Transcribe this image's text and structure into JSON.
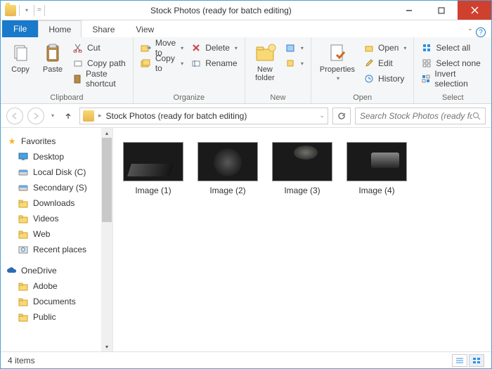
{
  "window": {
    "title": "Stock Photos (ready for batch editing)"
  },
  "tabs": {
    "file": "File",
    "home": "Home",
    "share": "Share",
    "view": "View"
  },
  "ribbon": {
    "clipboard": {
      "label": "Clipboard",
      "copy": "Copy",
      "paste": "Paste",
      "cut": "Cut",
      "copypath": "Copy path",
      "pasteshortcut": "Paste shortcut"
    },
    "organize": {
      "label": "Organize",
      "moveto": "Move to",
      "copyto": "Copy to",
      "delete": "Delete",
      "rename": "Rename"
    },
    "new": {
      "label": "New",
      "newfolder": "New\nfolder"
    },
    "open": {
      "label": "Open",
      "properties": "Properties",
      "open": "Open",
      "edit": "Edit",
      "history": "History"
    },
    "select": {
      "label": "Select",
      "selectall": "Select all",
      "selectnone": "Select none",
      "invert": "Invert selection"
    }
  },
  "breadcrumb": {
    "path": "Stock Photos (ready for batch editing)"
  },
  "search": {
    "placeholder": "Search Stock Photos (ready fo..."
  },
  "nav": {
    "favorites": "Favorites",
    "items": [
      {
        "label": "Desktop",
        "icon": "desktop"
      },
      {
        "label": "Local Disk (C)",
        "icon": "disk"
      },
      {
        "label": "Secondary (S)",
        "icon": "disk"
      },
      {
        "label": "Downloads",
        "icon": "folder"
      },
      {
        "label": "Videos",
        "icon": "folder"
      },
      {
        "label": "Web",
        "icon": "folder"
      },
      {
        "label": "Recent places",
        "icon": "recent"
      }
    ],
    "onedrive": "OneDrive",
    "od_items": [
      {
        "label": "Adobe"
      },
      {
        "label": "Documents"
      },
      {
        "label": "Public"
      }
    ]
  },
  "items": [
    {
      "label": "Image (1)"
    },
    {
      "label": "Image (2)"
    },
    {
      "label": "Image (3)"
    },
    {
      "label": "Image (4)"
    }
  ],
  "status": {
    "count": "4 items"
  }
}
